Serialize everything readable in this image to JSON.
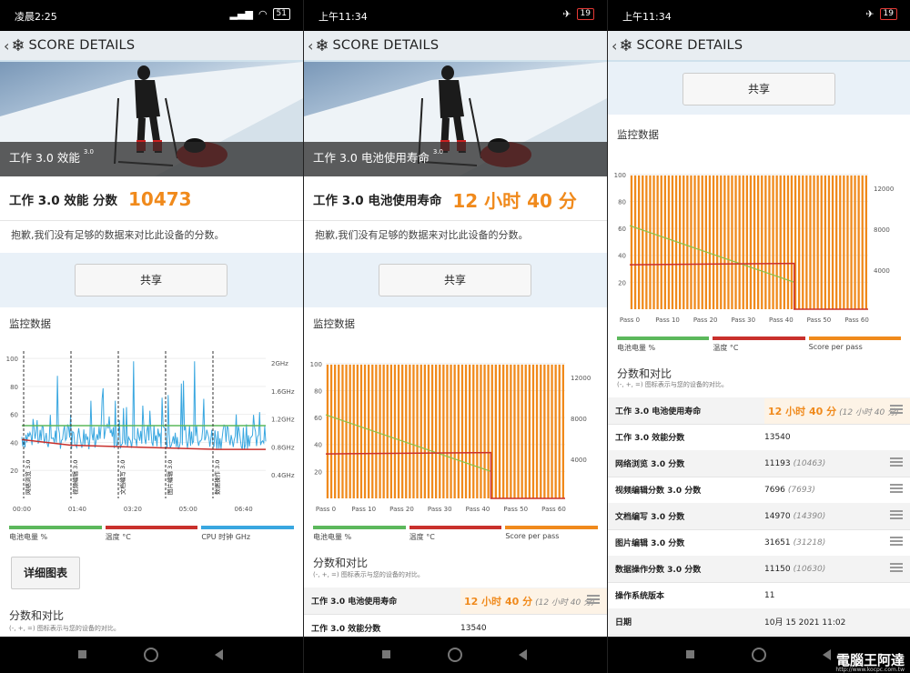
{
  "panels": [
    {
      "status": {
        "time": "凌晨2:25",
        "battery": "51"
      },
      "title": "SCORE DETAILS",
      "hero_label": "工作 3.0 效能",
      "hero_version": "3.0",
      "score_label": "工作 3.0 效能 分数",
      "score_value": "10473",
      "sorry": "抱歉,我们没有足够的数据来对比此设备的分数。",
      "share": "共享",
      "monitor": "监控数据",
      "legend": [
        "电池电量 %",
        "温度 °C",
        "CPU 时钟 GHz"
      ],
      "detail_button": "详细图表",
      "compare_title": "分数和对比",
      "compare_note": "(-, +, =) 图标表示与您的设备的对比。"
    },
    {
      "status": {
        "time": "上午11:34",
        "battery": "19"
      },
      "title": "SCORE DETAILS",
      "hero_label": "工作 3.0 电池使用寿命",
      "hero_version": "3.0",
      "score_label": "工作 3.0 电池使用寿命",
      "score_value": "12 小时 40 分",
      "sorry": "抱歉,我们没有足够的数据来对比此设备的分数。",
      "share": "共享",
      "monitor": "监控数据",
      "legend": [
        "电池电量 %",
        "温度 °C",
        "Score per pass"
      ],
      "compare_title": "分数和对比",
      "compare_note": "(-, +, =) 图标表示与您的设备的对比。",
      "rows": [
        {
          "label": "工作 3.0 电池使用寿命",
          "value": "12 小时 40 分",
          "compare": "(12 小时 40 分)"
        },
        {
          "label": "工作 3.0 效能分数",
          "value": "13540",
          "compare": ""
        }
      ]
    },
    {
      "status": {
        "time": "上午11:34",
        "battery": "19"
      },
      "title": "SCORE DETAILS",
      "share": "共享",
      "monitor": "监控数据",
      "legend": [
        "电池电量 %",
        "温度 °C",
        "Score per pass"
      ],
      "compare_title": "分数和对比",
      "compare_note": "(-, +, =) 图标表示与您的设备的对比。",
      "rows": [
        {
          "label": "工作 3.0 电池使用寿命",
          "value": "12 小时 40 分",
          "compare": "(12 小时 40 分)"
        },
        {
          "label": "工作 3.0 效能分数",
          "value": "13540",
          "compare": ""
        },
        {
          "label": "网络浏览 3.0 分数",
          "value": "11193",
          "compare": "(10463)"
        },
        {
          "label": "视频编辑分数 3.0 分数",
          "value": "7696",
          "compare": "(7693)"
        },
        {
          "label": "文档编写 3.0 分数",
          "value": "14970",
          "compare": "(14390)"
        },
        {
          "label": "图片编辑 3.0 分数",
          "value": "31651",
          "compare": "(31218)"
        },
        {
          "label": "数据操作分数 3.0 分数",
          "value": "11150",
          "compare": "(10630)"
        },
        {
          "label": "操作系统版本",
          "value": "11",
          "compare": ""
        },
        {
          "label": "日期",
          "value": "10月 15 2021 11:02",
          "compare": ""
        }
      ]
    }
  ],
  "chart_data": [
    {
      "type": "line",
      "yleft_ticks": [
        "100",
        "80",
        "60",
        "40",
        "20"
      ],
      "yright_ticks": [
        "2GHz",
        "1.6GHz",
        "1.2GHz",
        "0.8GHz",
        "0.4GHz"
      ],
      "x_ticks": [
        "00:00",
        "01:40",
        "03:20",
        "05:00",
        "06:40"
      ],
      "annotations": [
        "网络浏览 3.0",
        "视频编辑 3.0",
        "文档编写 3.0",
        "图片编辑 3.0",
        "数据操作 3.0"
      ],
      "series": [
        {
          "name": "电池电量 %",
          "color": "#5cb85c",
          "values": [
            52,
            52,
            52,
            52,
            52,
            52
          ]
        },
        {
          "name": "温度 °C",
          "color": "#c9302c",
          "values": [
            42,
            38,
            37,
            36,
            35,
            35
          ]
        },
        {
          "name": "CPU 时钟 GHz",
          "color": "#39a7e0"
        }
      ]
    },
    {
      "type": "bar",
      "yleft_ticks": [
        "100",
        "80",
        "60",
        "40",
        "20"
      ],
      "yright_ticks": [
        "12000",
        "8000",
        "4000"
      ],
      "x_ticks": [
        "Pass 0",
        "Pass 10",
        "Pass 20",
        "Pass 30",
        "Pass 40",
        "Pass 50",
        "Pass 60"
      ],
      "series": [
        {
          "name": "电池电量 %",
          "color": "#8bc34a",
          "values": [
            62,
            20
          ]
        },
        {
          "name": "温度 °C",
          "color": "#c9302c",
          "values": [
            33,
            34
          ]
        },
        {
          "name": "Score per pass",
          "color": "#f08a1c",
          "value_approx": 13200,
          "passes": 64
        }
      ]
    },
    {
      "type": "bar",
      "yleft_ticks": [
        "100",
        "80",
        "60",
        "40",
        "20"
      ],
      "yright_ticks": [
        "12000",
        "8000",
        "4000"
      ],
      "x_ticks": [
        "Pass 0",
        "Pass 10",
        "Pass 20",
        "Pass 30",
        "Pass 40",
        "Pass 50",
        "Pass 60"
      ],
      "series": [
        {
          "name": "电池电量 %",
          "color": "#8bc34a",
          "values": [
            62,
            20
          ]
        },
        {
          "name": "温度 °C",
          "color": "#c9302c",
          "values": [
            33,
            34
          ]
        },
        {
          "name": "Score per pass",
          "color": "#f08a1c",
          "value_approx": 13200,
          "passes": 64
        }
      ]
    }
  ],
  "watermark": "電腦王阿達",
  "watermark_url": "http://www.kocpc.com.tw"
}
